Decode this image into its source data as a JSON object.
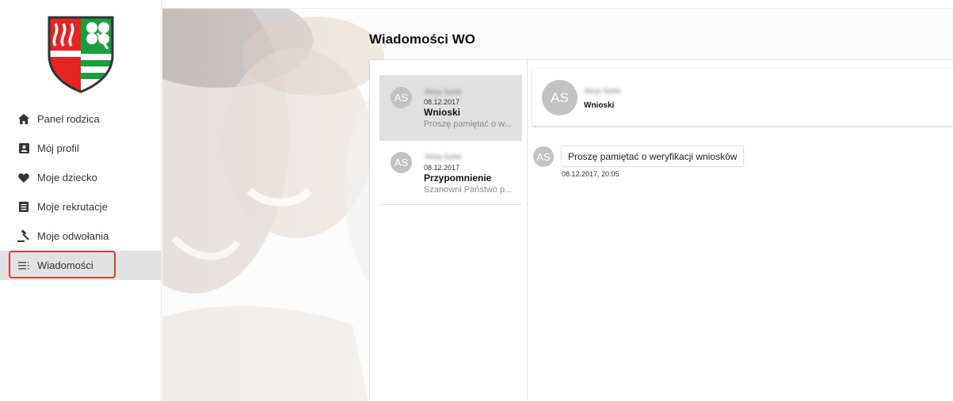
{
  "sidebar": {
    "items": [
      {
        "label": "Panel rodzica",
        "icon": "home-icon"
      },
      {
        "label": "Mój profil",
        "icon": "profile-card-icon"
      },
      {
        "label": "Moje dziecko",
        "icon": "heart-icon"
      },
      {
        "label": "Moje rekrutacje",
        "icon": "document-list-icon"
      },
      {
        "label": "Moje odwołania",
        "icon": "gavel-icon"
      },
      {
        "label": "Wiadomości",
        "icon": "messages-icon",
        "active": true
      }
    ]
  },
  "main": {
    "title": "Wiadomości WO",
    "conversations": [
      {
        "initials": "AS",
        "sender": "Alicja Sytek",
        "date": "08.12.2017",
        "subject": "Wnioski",
        "preview": "Proszę pamiętać o w...",
        "selected": true
      },
      {
        "initials": "AS",
        "sender": "Alicja Sytek",
        "date": "08.12.2017",
        "subject": "Przypomnienie",
        "preview": "Szanowni Państwo p...",
        "selected": false
      }
    ],
    "thread": {
      "initials": "AS",
      "sender": "Alicja Sytek",
      "subject": "Wnioski",
      "messages": [
        {
          "initials": "AS",
          "text": "Proszę pamiętać o weryfikacji wniosków",
          "time": "08.12.2017, 20:05"
        }
      ]
    }
  },
  "colors": {
    "accent_red": "#e0383d",
    "avatar_gray": "#c2c2c2",
    "selected_bg": "#e0e0e0",
    "crest_red": "#e52424",
    "crest_green": "#1a9e3b"
  }
}
